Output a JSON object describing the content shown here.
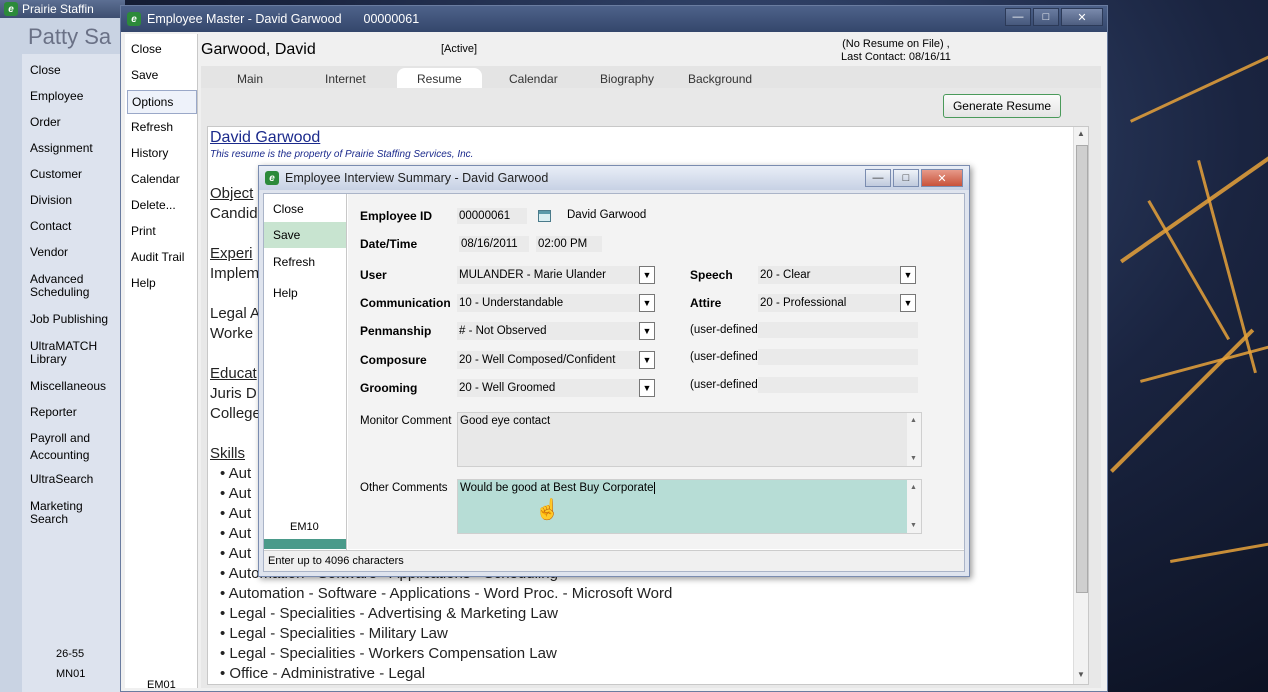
{
  "app": {
    "title": "Prairie Staffin",
    "user": "Patty Sa",
    "nav": [
      "Close",
      "Employee",
      "Order",
      "Assignment",
      "Customer",
      "Division",
      "Contact",
      "Vendor",
      "Advanced Scheduling",
      "Job Publishing",
      "UltraMATCH Library",
      "Miscellaneous",
      "Reporter",
      "Payroll and Accounting",
      "UltraSearch",
      "Marketing Search"
    ],
    "footer_code_1": "26-55",
    "footer_code_2": "MN01"
  },
  "employee_window": {
    "title": "Employee Master - David Garwood",
    "id": "00000061",
    "menu": [
      "Close",
      "Save",
      "Options",
      "Refresh",
      "History",
      "Calendar",
      "Delete...",
      "Print",
      "Audit Trail",
      "Help"
    ],
    "menu_selected": "Options",
    "footer_code": "EM01",
    "name": "Garwood, David",
    "status": "[Active]",
    "resume_note_1": "(No Resume on File) ,",
    "resume_note_2": "Last Contact: 08/16/11",
    "tabs": [
      "Main",
      "Internet",
      "Resume",
      "Calendar",
      "Biography",
      "Background"
    ],
    "active_tab": "Resume",
    "generate_button": "Generate Resume",
    "resume": {
      "name": "David Garwood",
      "property_note": "This resume is the property of Prairie Staffing Services, Inc.",
      "lines": [
        "Object",
        "Candid",
        "Experi",
        "Implem",
        "Legal A",
        "Worke",
        "Educat",
        "Juris D",
        "College",
        "Skills"
      ],
      "bullets": [
        "Aut",
        "Aut",
        "Aut",
        "Aut",
        "Aut",
        "Automation - Software - Applications - Scheduling",
        "Automation - Software - Applications - Word Proc. - Microsoft Word",
        "Legal - Specialities - Advertising & Marketing Law",
        "Legal - Specialities - Military Law",
        "Legal - Specialities - Workers Compensation Law",
        "Office - Administrative - Legal"
      ]
    }
  },
  "dialog": {
    "title": "Employee Interview Summary - David Garwood",
    "menu": [
      "Close",
      "Save",
      "Refresh",
      "Help"
    ],
    "menu_selected": "Save",
    "code": "EM10",
    "status_text": "Enter up to 4096 characters",
    "employee_id_label": "Employee ID",
    "employee_id": "00000061",
    "employee_name": "David Garwood",
    "datetime_label": "Date/Time",
    "date": "08/16/2011",
    "time": "02:00 PM",
    "fields_left": [
      {
        "label": "User",
        "value": "MULANDER - Marie Ulander"
      },
      {
        "label": "Communication",
        "value": "10 - Understandable"
      },
      {
        "label": "Penmanship",
        "value": "# - Not Observed"
      },
      {
        "label": "Composure",
        "value": "20 - Well Composed/Confident"
      },
      {
        "label": "Grooming",
        "value": "20 - Well Groomed"
      }
    ],
    "fields_right": [
      {
        "label": "Speech",
        "value": "20 - Clear"
      },
      {
        "label": "Attire",
        "value": "20 - Professional"
      }
    ],
    "user_defined_label": "(user-defined)",
    "monitor_comment_label": "Monitor Comment",
    "monitor_comment": "Good eye contact",
    "other_comments_label": "Other Comments",
    "other_comments": "Would be good at Best Buy Corporate"
  }
}
